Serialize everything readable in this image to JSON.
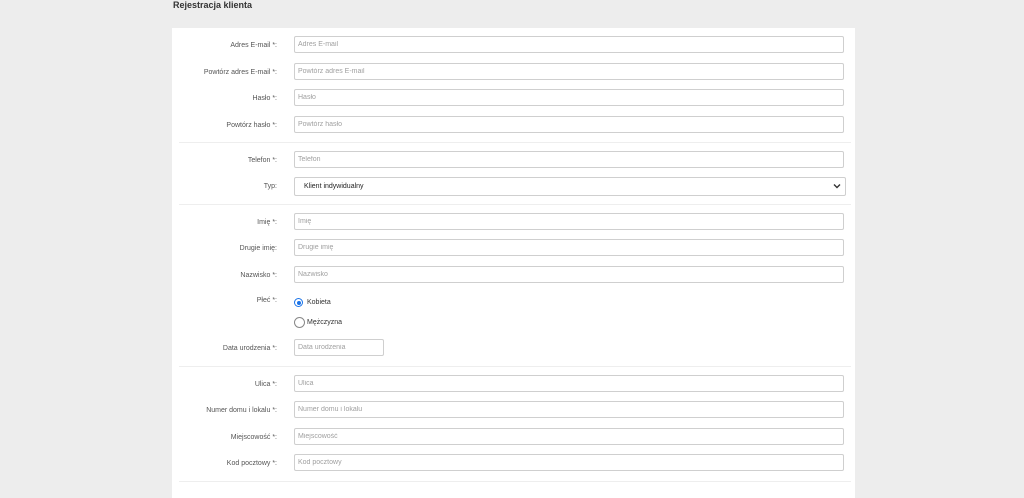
{
  "page": {
    "title": "Rejestracja klienta"
  },
  "account": {
    "email": {
      "label": "Adres E-mail *:",
      "placeholder": "Adres E-mail",
      "value": ""
    },
    "email_repeat": {
      "label": "Powtórz adres E-mail *:",
      "placeholder": "Powtórz adres E-mail",
      "value": ""
    },
    "password": {
      "label": "Hasło *:",
      "placeholder": "Hasło",
      "value": ""
    },
    "password_repeat": {
      "label": "Powtórz hasło *:",
      "placeholder": "Powtórz hasło",
      "value": ""
    }
  },
  "contact": {
    "phone": {
      "label": "Telefon *:",
      "placeholder": "Telefon",
      "value": ""
    },
    "type": {
      "label": "Typ:",
      "selected": "Klient indywidualny"
    }
  },
  "person": {
    "first_name": {
      "label": "Imię *:",
      "placeholder": "Imię",
      "value": ""
    },
    "middle_name": {
      "label": "Drugie imię:",
      "placeholder": "Drugie imię",
      "value": ""
    },
    "last_name": {
      "label": "Nazwisko *:",
      "placeholder": "Nazwisko",
      "value": ""
    },
    "gender": {
      "label": "Płeć *:",
      "options": [
        {
          "label": "Kobieta",
          "checked": true
        },
        {
          "label": "Mężczyzna",
          "checked": false
        }
      ]
    },
    "birth_date": {
      "label": "Data urodzenia *:",
      "placeholder": "Data urodzenia",
      "value": ""
    }
  },
  "address": {
    "street": {
      "label": "Ulica *:",
      "placeholder": "Ulica",
      "value": ""
    },
    "house_number": {
      "label": "Numer domu i lokalu *:",
      "placeholder": "Numer domu i lokalu",
      "value": ""
    },
    "city": {
      "label": "Miejscowość *:",
      "placeholder": "Miejscowość",
      "value": ""
    },
    "postal_code": {
      "label": "Kod pocztowy *:",
      "placeholder": "Kod pocztowy",
      "value": ""
    }
  },
  "colors": {
    "background": "#ededed",
    "card": "#ffffff",
    "border": "#cfcfcf",
    "accent": "#1a73e8"
  }
}
